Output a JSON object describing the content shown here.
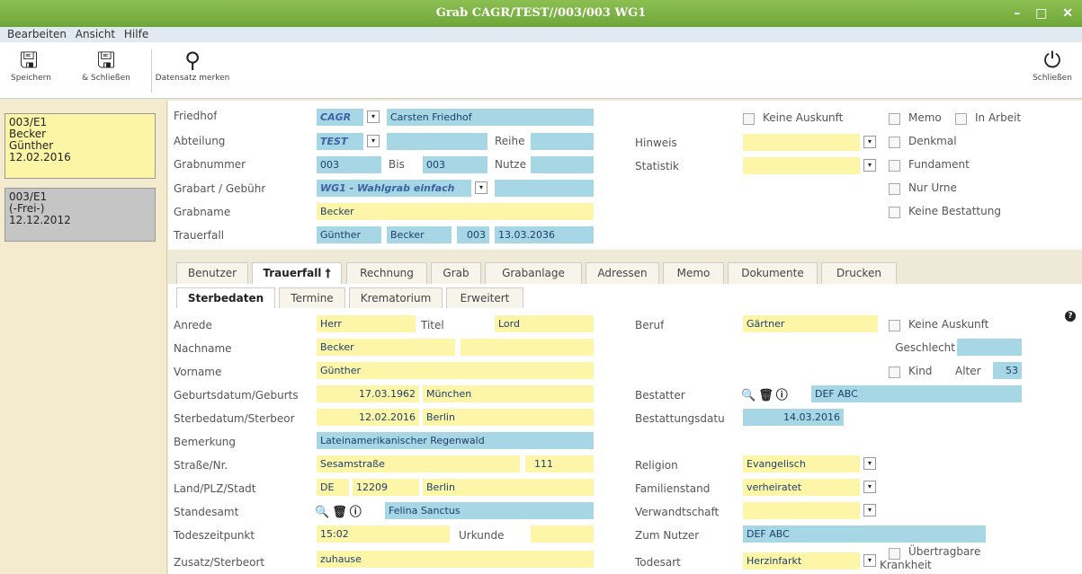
{
  "window": {
    "title": "Grab CAGR/TEST//003/003 WG1",
    "controls": "– □ ✕"
  },
  "menu": [
    "Bearbeiten",
    "Ansicht",
    "Hilfe"
  ],
  "toolbar": {
    "save": "Speichern",
    "save_close": "& Schließen",
    "bookmark": "Datensatz merken",
    "close": "Schließen"
  },
  "sidebar": [
    {
      "l1": "003/E1",
      "l2": "Becker",
      "l3": "Günther",
      "l4": "12.02.2016"
    },
    {
      "l1": "003/E1",
      "l2": "(-Frei-)",
      "l3": "12.12.2012"
    }
  ],
  "header": {
    "friedhof_label": "Friedhof",
    "friedhof_code": "CAGR",
    "friedhof_name": "Carsten Friedhof",
    "abteilung_label": "Abteilung",
    "abteilung_code": "TEST",
    "reihe_label": "Reihe",
    "reihe_value": "",
    "grabnummer_label": "Grabnummer",
    "grabnummer": "003",
    "bis_label": "Bis",
    "bis": "003",
    "nutze_label": "Nutze",
    "nutze_value": "",
    "grabart_label": "Grabart / Gebühr",
    "grabart": "WG1 - Wahlgrab einfach",
    "gebuehr": "",
    "grabname_label": "Grabname",
    "grabname": "Becker",
    "trauerfall_label": "Trauerfall",
    "tf_vorname": "Günther",
    "tf_nachname": "Becker",
    "tf_nr": "003",
    "tf_datum": "13.03.2036",
    "hinweis_label": "Hinweis",
    "hinweis_value": "",
    "statistik_label": "Statistik",
    "statistik_value": "",
    "keine_auskunft": "Keine Auskunft",
    "memo": "Memo",
    "in_arbeit": "In Arbeit",
    "denkmal": "Denkmal",
    "fundament": "Fundament",
    "nur_urne": "Nur Urne",
    "keine_bestattung": "Keine Bestattung"
  },
  "tabs": [
    "Benutzer",
    "Trauerfall",
    "Rechnung",
    "Grab",
    "Grabanlage",
    "Adressen",
    "Memo",
    "Dokumente",
    "Drucken"
  ],
  "active_tab_marker": "†",
  "subtabs": [
    "Sterbedaten",
    "Termine",
    "Krematorium",
    "Erweitert"
  ],
  "help_icon": "?",
  "form": {
    "anrede_label": "Anrede",
    "anrede": "Herr",
    "titel_label": "Titel",
    "titel": "Lord",
    "nachname_label": "Nachname",
    "nachname": "Becker",
    "nachname2": "",
    "vorname_label": "Vorname",
    "vorname": "Günther",
    "geburt_label": "Geburtsdatum/Geburts",
    "geburt_datum": "17.03.1962",
    "geburt_ort": "München",
    "sterbe_label": "Sterbedatum/Sterbeor",
    "sterbe_datum": "12.02.2016",
    "sterbe_ort": "Berlin",
    "bemerkung_label": "Bemerkung",
    "bemerkung": "Lateinamerikanischer Regenwald",
    "strasse_label": "Straße/Nr.",
    "strasse": "Sesamstraße",
    "hausnr": "111",
    "land_label": "Land/PLZ/Stadt",
    "land": "DE",
    "plz": "12209",
    "stadt": "Berlin",
    "standesamt_label": "Standesamt",
    "standesamt": "Felina Sanctus",
    "todeszeit_label": "Todeszeitpunkt",
    "todeszeit": "15:02",
    "urkunde_label": "Urkunde",
    "urkunde": "",
    "zusatz_label": "Zusatz/Sterbeort",
    "zusatz": "zuhause",
    "beruf_label": "Beruf",
    "beruf": "Gärtner",
    "keine_auskunft": "Keine Auskunft",
    "geschlecht_label": "Geschlecht",
    "geschlecht": "",
    "kind_label": "Kind",
    "alter_label": "Alter",
    "alter": "53",
    "bestatter_label": "Bestatter",
    "bestatter": "DEF ABC",
    "bestattungsdatum_label": "Bestattungsdatu",
    "bestattungsdatum": "14.03.2016",
    "religion_label": "Religion",
    "religion": "Evangelisch",
    "familienstand_label": "Familienstand",
    "familienstand": "verheiratet",
    "verwandtschaft_label": "Verwandtschaft",
    "verwandtschaft": "",
    "zum_nutzer_label": "Zum Nutzer",
    "zum_nutzer": "DEF ABC",
    "todesart_label": "Todesart",
    "todesart": "Herzinfarkt",
    "uebertragbar_label": "Übertragbare Krankheit"
  }
}
